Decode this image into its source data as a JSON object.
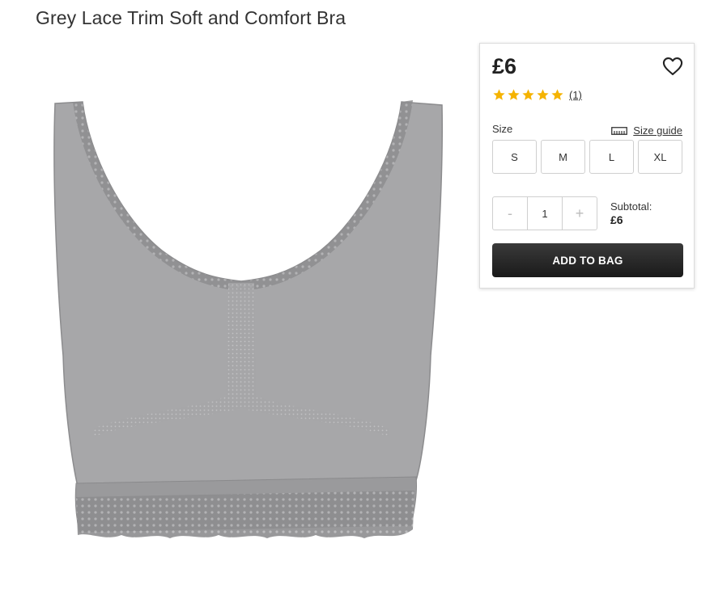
{
  "product": {
    "title": "Grey Lace Trim Soft and Comfort Bra",
    "image": "grey-lace-trim-bra"
  },
  "buy_box": {
    "price": "£6",
    "wishlist_icon": "heart-icon",
    "rating": {
      "stars": 5,
      "review_count": "(1)",
      "star_color": "#f5b301"
    },
    "size_label": "Size",
    "size_guide_label": "Size guide",
    "size_guide_icon": "ruler-icon",
    "sizes": [
      "S",
      "M",
      "L",
      "XL"
    ],
    "quantity": {
      "decrement": "-",
      "value": "1",
      "increment": "+"
    },
    "subtotal_label": "Subtotal:",
    "subtotal_value": "£6",
    "add_to_bag_label": "ADD TO BAG"
  }
}
